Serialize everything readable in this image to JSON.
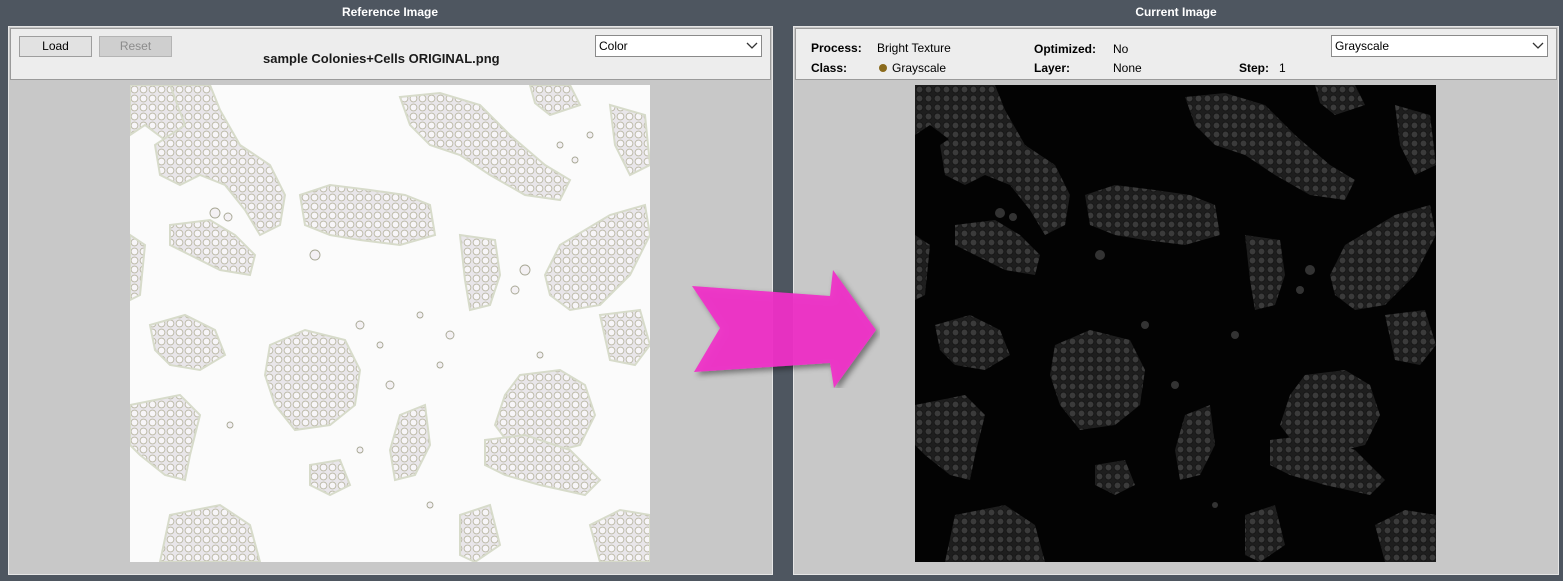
{
  "reference": {
    "title": "Reference Image",
    "load_label": "Load",
    "reset_label": "Reset",
    "filename": "sample Colonies+Cells ORIGINAL.png",
    "color_mode": "Color"
  },
  "current": {
    "title": "Current Image",
    "process_label": "Process:",
    "process_value": "Bright Texture",
    "class_label": "Class:",
    "class_value": "Grayscale",
    "optimized_label": "Optimized:",
    "optimized_value": "No",
    "layer_label": "Layer:",
    "layer_value": "None",
    "step_label": "Step:",
    "step_value": "1",
    "color_mode": "Grayscale"
  },
  "colors": {
    "background": "#4e5660",
    "panel": "#c8c8c8",
    "arrow": "#f02ec8",
    "class_dot": "#8a6a1c"
  },
  "icons": {
    "dropdown": "chevron-down-icon",
    "transition": "arrow-right-icon"
  }
}
